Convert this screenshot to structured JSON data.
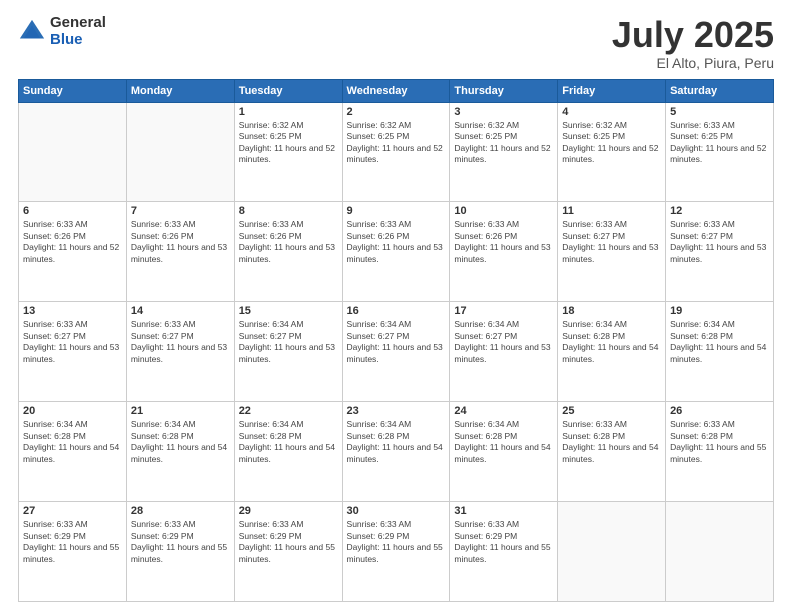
{
  "logo": {
    "general": "General",
    "blue": "Blue"
  },
  "title": {
    "month": "July 2025",
    "location": "El Alto, Piura, Peru"
  },
  "header_days": [
    "Sunday",
    "Monday",
    "Tuesday",
    "Wednesday",
    "Thursday",
    "Friday",
    "Saturday"
  ],
  "weeks": [
    [
      {
        "day": "",
        "detail": ""
      },
      {
        "day": "",
        "detail": ""
      },
      {
        "day": "1",
        "detail": "Sunrise: 6:32 AM\nSunset: 6:25 PM\nDaylight: 11 hours and 52 minutes."
      },
      {
        "day": "2",
        "detail": "Sunrise: 6:32 AM\nSunset: 6:25 PM\nDaylight: 11 hours and 52 minutes."
      },
      {
        "day": "3",
        "detail": "Sunrise: 6:32 AM\nSunset: 6:25 PM\nDaylight: 11 hours and 52 minutes."
      },
      {
        "day": "4",
        "detail": "Sunrise: 6:32 AM\nSunset: 6:25 PM\nDaylight: 11 hours and 52 minutes."
      },
      {
        "day": "5",
        "detail": "Sunrise: 6:33 AM\nSunset: 6:25 PM\nDaylight: 11 hours and 52 minutes."
      }
    ],
    [
      {
        "day": "6",
        "detail": "Sunrise: 6:33 AM\nSunset: 6:26 PM\nDaylight: 11 hours and 52 minutes."
      },
      {
        "day": "7",
        "detail": "Sunrise: 6:33 AM\nSunset: 6:26 PM\nDaylight: 11 hours and 53 minutes."
      },
      {
        "day": "8",
        "detail": "Sunrise: 6:33 AM\nSunset: 6:26 PM\nDaylight: 11 hours and 53 minutes."
      },
      {
        "day": "9",
        "detail": "Sunrise: 6:33 AM\nSunset: 6:26 PM\nDaylight: 11 hours and 53 minutes."
      },
      {
        "day": "10",
        "detail": "Sunrise: 6:33 AM\nSunset: 6:26 PM\nDaylight: 11 hours and 53 minutes."
      },
      {
        "day": "11",
        "detail": "Sunrise: 6:33 AM\nSunset: 6:27 PM\nDaylight: 11 hours and 53 minutes."
      },
      {
        "day": "12",
        "detail": "Sunrise: 6:33 AM\nSunset: 6:27 PM\nDaylight: 11 hours and 53 minutes."
      }
    ],
    [
      {
        "day": "13",
        "detail": "Sunrise: 6:33 AM\nSunset: 6:27 PM\nDaylight: 11 hours and 53 minutes."
      },
      {
        "day": "14",
        "detail": "Sunrise: 6:33 AM\nSunset: 6:27 PM\nDaylight: 11 hours and 53 minutes."
      },
      {
        "day": "15",
        "detail": "Sunrise: 6:34 AM\nSunset: 6:27 PM\nDaylight: 11 hours and 53 minutes."
      },
      {
        "day": "16",
        "detail": "Sunrise: 6:34 AM\nSunset: 6:27 PM\nDaylight: 11 hours and 53 minutes."
      },
      {
        "day": "17",
        "detail": "Sunrise: 6:34 AM\nSunset: 6:27 PM\nDaylight: 11 hours and 53 minutes."
      },
      {
        "day": "18",
        "detail": "Sunrise: 6:34 AM\nSunset: 6:28 PM\nDaylight: 11 hours and 54 minutes."
      },
      {
        "day": "19",
        "detail": "Sunrise: 6:34 AM\nSunset: 6:28 PM\nDaylight: 11 hours and 54 minutes."
      }
    ],
    [
      {
        "day": "20",
        "detail": "Sunrise: 6:34 AM\nSunset: 6:28 PM\nDaylight: 11 hours and 54 minutes."
      },
      {
        "day": "21",
        "detail": "Sunrise: 6:34 AM\nSunset: 6:28 PM\nDaylight: 11 hours and 54 minutes."
      },
      {
        "day": "22",
        "detail": "Sunrise: 6:34 AM\nSunset: 6:28 PM\nDaylight: 11 hours and 54 minutes."
      },
      {
        "day": "23",
        "detail": "Sunrise: 6:34 AM\nSunset: 6:28 PM\nDaylight: 11 hours and 54 minutes."
      },
      {
        "day": "24",
        "detail": "Sunrise: 6:34 AM\nSunset: 6:28 PM\nDaylight: 11 hours and 54 minutes."
      },
      {
        "day": "25",
        "detail": "Sunrise: 6:33 AM\nSunset: 6:28 PM\nDaylight: 11 hours and 54 minutes."
      },
      {
        "day": "26",
        "detail": "Sunrise: 6:33 AM\nSunset: 6:28 PM\nDaylight: 11 hours and 55 minutes."
      }
    ],
    [
      {
        "day": "27",
        "detail": "Sunrise: 6:33 AM\nSunset: 6:29 PM\nDaylight: 11 hours and 55 minutes."
      },
      {
        "day": "28",
        "detail": "Sunrise: 6:33 AM\nSunset: 6:29 PM\nDaylight: 11 hours and 55 minutes."
      },
      {
        "day": "29",
        "detail": "Sunrise: 6:33 AM\nSunset: 6:29 PM\nDaylight: 11 hours and 55 minutes."
      },
      {
        "day": "30",
        "detail": "Sunrise: 6:33 AM\nSunset: 6:29 PM\nDaylight: 11 hours and 55 minutes."
      },
      {
        "day": "31",
        "detail": "Sunrise: 6:33 AM\nSunset: 6:29 PM\nDaylight: 11 hours and 55 minutes."
      },
      {
        "day": "",
        "detail": ""
      },
      {
        "day": "",
        "detail": ""
      }
    ]
  ]
}
